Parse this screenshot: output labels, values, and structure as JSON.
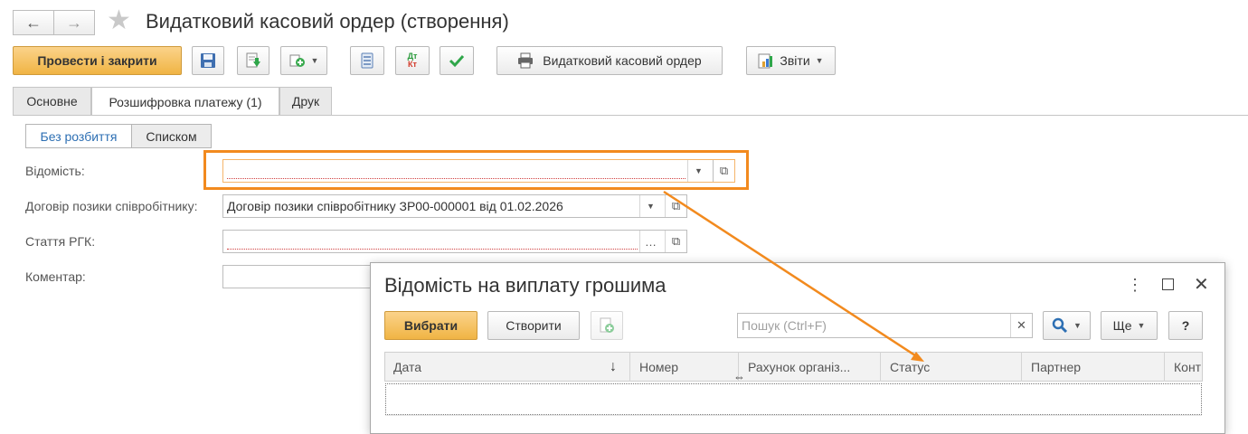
{
  "window": {
    "title": "Видатковий касовий ордер (створення)"
  },
  "toolbar": {
    "post_close_label": "Провести і закрити",
    "print_form_label": "Видатковий касовий ордер",
    "reports_label": "Звіти",
    "dtkt_label_top": "Дт",
    "dtkt_label_bottom": "Кт"
  },
  "tabs": [
    {
      "label": "Основне"
    },
    {
      "label": "Розшифровка платежу (1)"
    },
    {
      "label": "Друк"
    }
  ],
  "segmented": [
    {
      "label": "Без розбиття"
    },
    {
      "label": "Списком"
    }
  ],
  "form": {
    "statement_label": "Відомість:",
    "statement_value": "",
    "loan_label": "Договір позики співробітнику:",
    "loan_value": "Договір позики співробітнику ЗР00-000001 від 01.02.2026",
    "rgk_label": "Стаття РГК:",
    "rgk_value": "",
    "comment_label": "Коментар:",
    "comment_value": ""
  },
  "dialog": {
    "title": "Відомість на виплату грошима",
    "select_label": "Вибрати",
    "create_label": "Створити",
    "search_placeholder": "Пошук (Ctrl+F)",
    "more_label": "Ще",
    "help_label": "?",
    "columns": [
      "Дата",
      "Номер",
      "Рахунок організ...",
      "Статус",
      "Партнер",
      "Конт"
    ]
  },
  "colors": {
    "highlight": "#f28a1e",
    "primary_button": "#f4c062",
    "link_tab": "#2d6fb3"
  }
}
